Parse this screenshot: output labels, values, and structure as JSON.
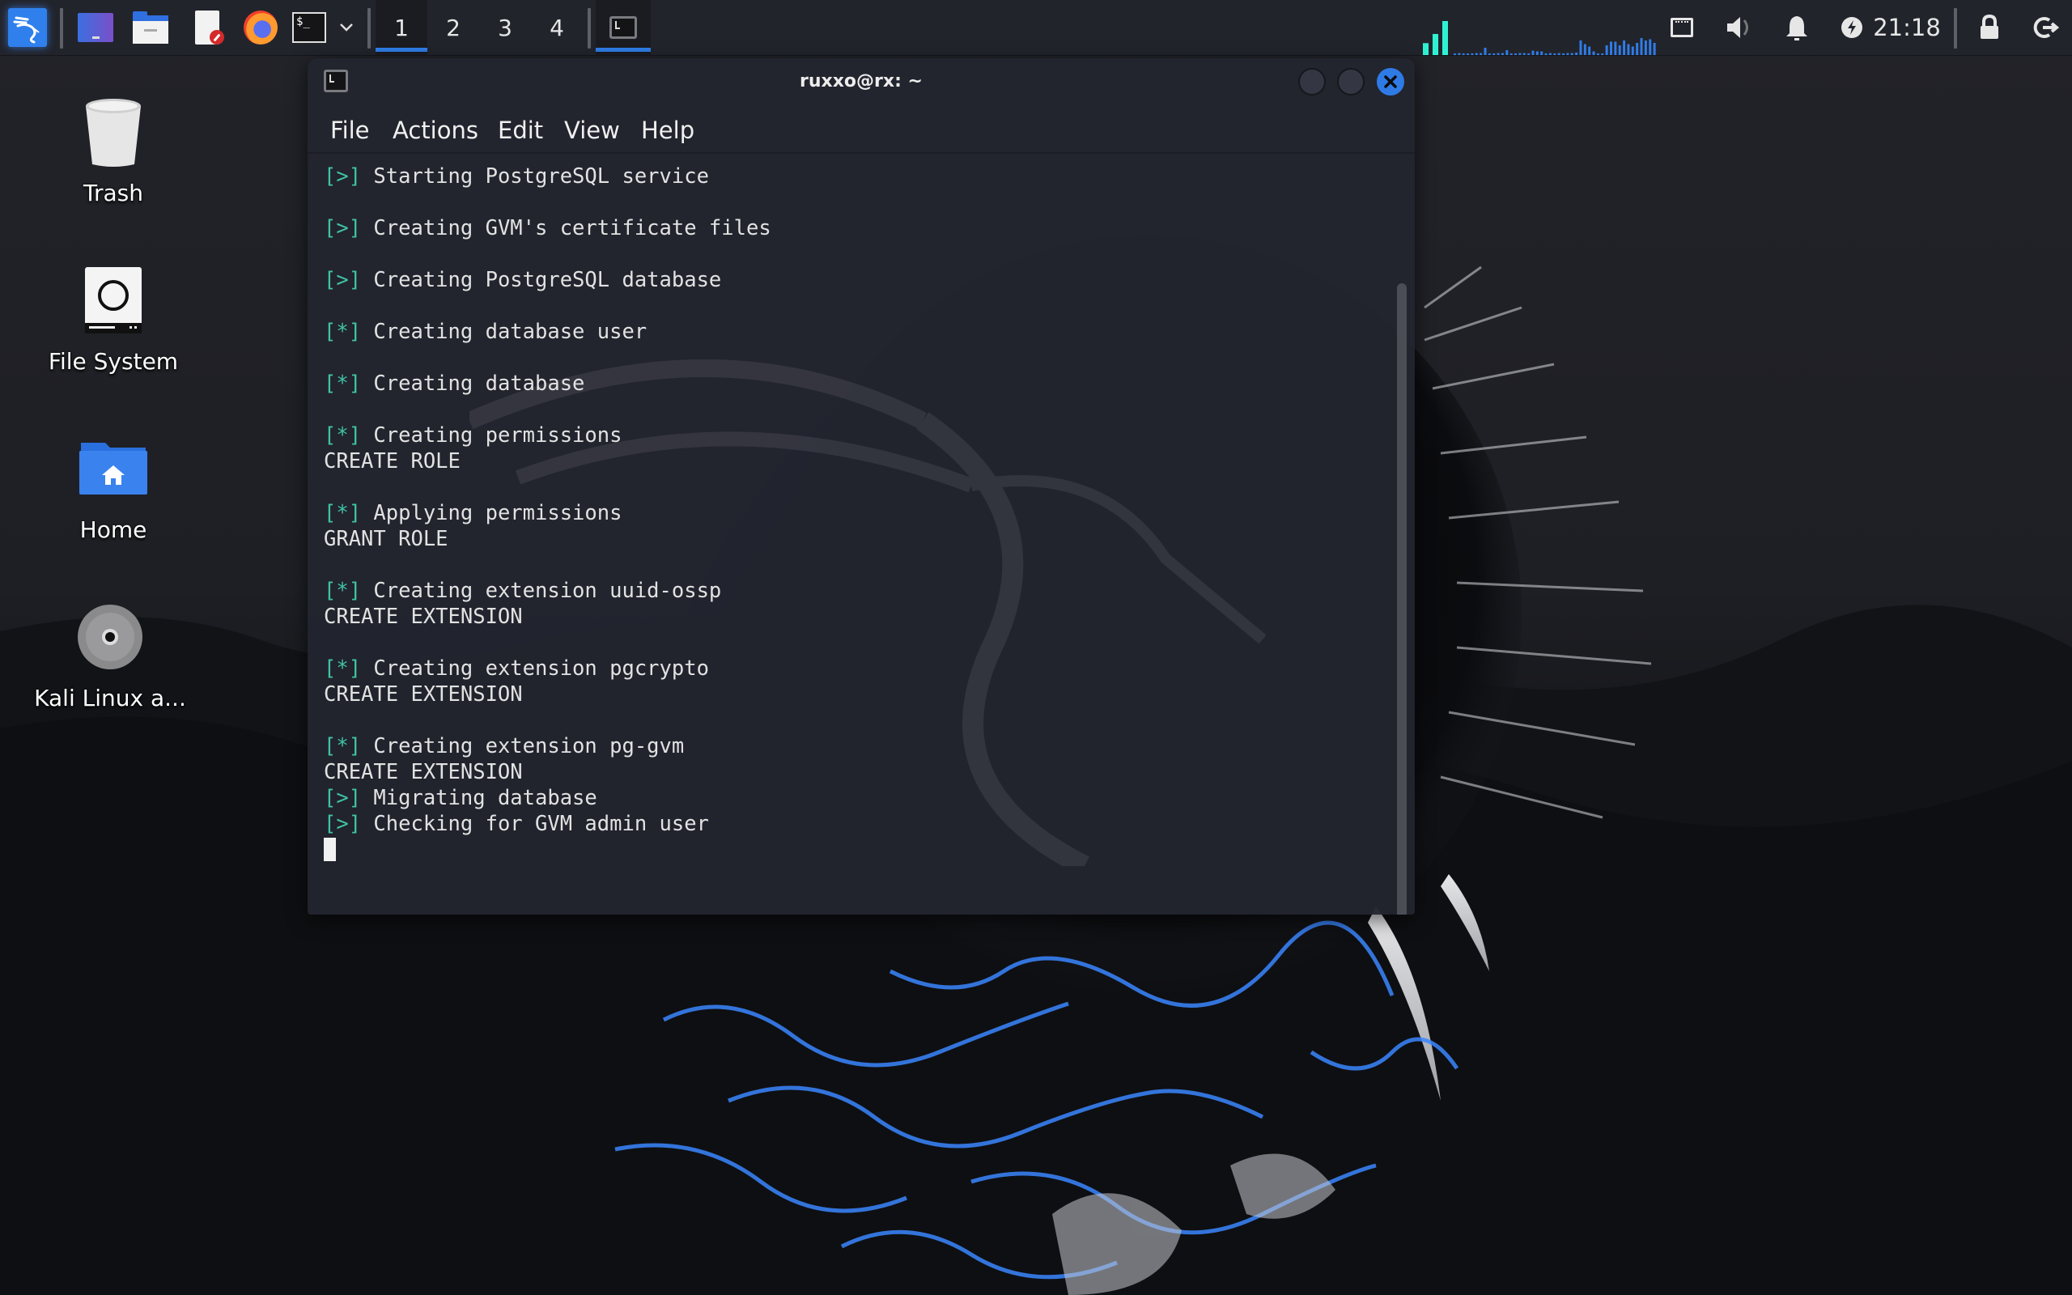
{
  "taskbar": {
    "launchers": [
      {
        "name": "kali-menu",
        "icon": "kali-dragon-icon"
      },
      {
        "name": "show-desktop",
        "icon": "desktop-icon"
      },
      {
        "name": "file-manager",
        "icon": "folder-icon"
      },
      {
        "name": "text-editor",
        "icon": "text-editor-icon"
      },
      {
        "name": "firefox",
        "icon": "firefox-icon"
      },
      {
        "name": "terminal",
        "icon": "terminal-icon"
      }
    ],
    "launcher_dropdown_icon": "chevron-down-icon",
    "workspaces": [
      {
        "label": "1",
        "active": true
      },
      {
        "label": "2",
        "active": false
      },
      {
        "label": "3",
        "active": false
      },
      {
        "label": "4",
        "active": false
      }
    ],
    "active_task": {
      "icon": "terminal-icon",
      "title": "ruxxo@rx: ~"
    },
    "cpu_graph": {
      "cores": [
        0.35,
        0.62,
        1.0
      ],
      "history": [
        0.05,
        0.08,
        0.05,
        0.05,
        0.05,
        0.08,
        0.08,
        0.3,
        0.05,
        0.05,
        0.08,
        0.08,
        0.2,
        0.05,
        0.05,
        0.08,
        0.08,
        0.05,
        0.18,
        0.15,
        0.15,
        0.05,
        0.08,
        0.05,
        0.08,
        0.05,
        0.08,
        0.08,
        0.1,
        0.6,
        0.45,
        0.35,
        0.15,
        0.05,
        0.05,
        0.4,
        0.55,
        0.55,
        0.4,
        0.6,
        0.45,
        0.35,
        0.5,
        0.7,
        0.6,
        0.65,
        0.5
      ]
    },
    "tray": {
      "network_icon": "network-wired-icon",
      "volume_icon": "volume-icon",
      "notifications_icon": "bell-icon",
      "power_icon": "power-manager-icon",
      "clock": "21:18",
      "lock_icon": "lock-icon",
      "logout_icon": "logout-icon"
    },
    "colors": {
      "accent": "#2f7de8",
      "cpu_cores": "#2ff2d2",
      "cpu_history": "#2f7de8"
    }
  },
  "desktop": {
    "icons": [
      {
        "label": "Trash",
        "icon": "trash-icon"
      },
      {
        "label": "File System",
        "icon": "drive-icon"
      },
      {
        "label": "Home",
        "icon": "home-folder-icon"
      },
      {
        "label": "Kali Linux a...",
        "icon": "optical-disc-icon"
      }
    ]
  },
  "terminal": {
    "title": "ruxxo@rx: ~",
    "menu": [
      "File",
      "Actions",
      "Edit",
      "View",
      "Help"
    ],
    "lines": [
      {
        "prefix": "[>]",
        "text": " Starting PostgreSQL service"
      },
      {
        "prefix": "",
        "text": ""
      },
      {
        "prefix": "[>]",
        "text": " Creating GVM's certificate files"
      },
      {
        "prefix": "",
        "text": ""
      },
      {
        "prefix": "[>]",
        "text": " Creating PostgreSQL database"
      },
      {
        "prefix": "",
        "text": ""
      },
      {
        "prefix": "[*]",
        "text": " Creating database user"
      },
      {
        "prefix": "",
        "text": ""
      },
      {
        "prefix": "[*]",
        "text": " Creating database"
      },
      {
        "prefix": "",
        "text": ""
      },
      {
        "prefix": "[*]",
        "text": " Creating permissions"
      },
      {
        "prefix": "",
        "text": "CREATE ROLE"
      },
      {
        "prefix": "",
        "text": ""
      },
      {
        "prefix": "[*]",
        "text": " Applying permissions"
      },
      {
        "prefix": "",
        "text": "GRANT ROLE"
      },
      {
        "prefix": "",
        "text": ""
      },
      {
        "prefix": "[*]",
        "text": " Creating extension uuid-ossp"
      },
      {
        "prefix": "",
        "text": "CREATE EXTENSION"
      },
      {
        "prefix": "",
        "text": ""
      },
      {
        "prefix": "[*]",
        "text": " Creating extension pgcrypto"
      },
      {
        "prefix": "",
        "text": "CREATE EXTENSION"
      },
      {
        "prefix": "",
        "text": ""
      },
      {
        "prefix": "[*]",
        "text": " Creating extension pg-gvm"
      },
      {
        "prefix": "",
        "text": "CREATE EXTENSION"
      },
      {
        "prefix": "[>]",
        "text": " Migrating database"
      },
      {
        "prefix": "[>]",
        "text": " Checking for GVM admin user"
      }
    ],
    "colors": {
      "prefix": "#3fc3a3",
      "text": "#e2e2e2",
      "background": "#22242e",
      "close_button": "#2f7be6"
    }
  }
}
